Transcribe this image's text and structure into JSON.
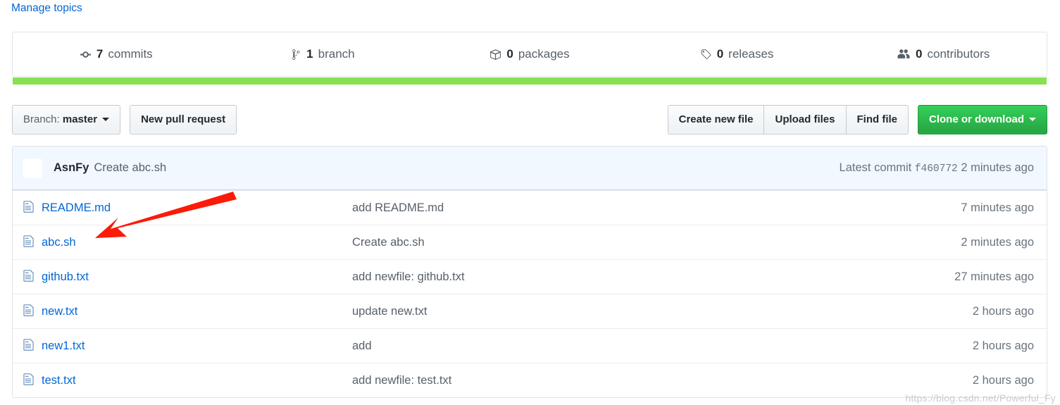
{
  "header": {
    "manage_topics_label": "Manage topics"
  },
  "stats": {
    "items": [
      {
        "icon": "commits-icon",
        "count": "7",
        "label": "commits",
        "name": "stat-commits"
      },
      {
        "icon": "branch-icon",
        "count": "1",
        "label": "branch",
        "name": "stat-branches"
      },
      {
        "icon": "package-icon",
        "count": "0",
        "label": "packages",
        "name": "stat-packages"
      },
      {
        "icon": "tag-icon",
        "count": "0",
        "label": "releases",
        "name": "stat-releases"
      },
      {
        "icon": "people-icon",
        "count": "0",
        "label": "contributors",
        "name": "stat-contributors"
      }
    ],
    "language_bar_color": "#89e051"
  },
  "toolbar": {
    "branch_prefix": "Branch:",
    "branch_name": "master",
    "new_pull_request_label": "New pull request",
    "create_new_file_label": "Create new file",
    "upload_files_label": "Upload files",
    "find_file_label": "Find file",
    "clone_or_download_label": "Clone or download",
    "clone_button_color": "#28a745"
  },
  "latest_commit": {
    "author": "AsnFy",
    "message": "Create abc.sh",
    "meta_prefix": "Latest commit",
    "sha": "f460772",
    "time": "2 minutes ago"
  },
  "files": [
    {
      "name": "README.md",
      "message": "add README.md",
      "time": "7 minutes ago"
    },
    {
      "name": "abc.sh",
      "message": "Create abc.sh",
      "time": "2 minutes ago"
    },
    {
      "name": "github.txt",
      "message": "add newfile: github.txt",
      "time": "27 minutes ago"
    },
    {
      "name": "new.txt",
      "message": "update new.txt",
      "time": "2 hours ago"
    },
    {
      "name": "new1.txt",
      "message": "add",
      "time": "2 hours ago"
    },
    {
      "name": "test.txt",
      "message": "add newfile: test.txt",
      "time": "2 hours ago"
    }
  ],
  "annotation": {
    "arrow_color": "#fb1b08"
  },
  "watermark": {
    "text": "https://blog.csdn.net/Powerful_Fy"
  }
}
